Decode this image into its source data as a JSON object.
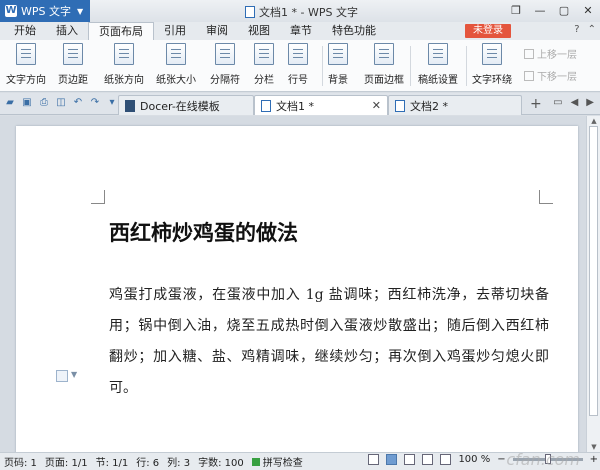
{
  "app": {
    "name": "WPS 文字",
    "window_title": "文档1 * - WPS 文字"
  },
  "menu": {
    "tabs": [
      "开始",
      "插入",
      "页面布局",
      "引用",
      "审阅",
      "视图",
      "章节",
      "特色功能"
    ],
    "active_tab": "页面布局",
    "login_label": "未登录"
  },
  "ribbon": {
    "buttons": [
      "文字方向",
      "页边距",
      "纸张方向",
      "纸张大小",
      "分隔符",
      "分栏",
      "行号",
      "背景",
      "页面边框",
      "稿纸设置",
      "文字环绕"
    ],
    "bring_forward": "上移一层",
    "send_backward": "下移一层"
  },
  "doc_tabs": [
    {
      "label": "Docer-在线模板",
      "active": false
    },
    {
      "label": "文档1 *",
      "active": true
    },
    {
      "label": "文档2 *",
      "active": false
    }
  ],
  "document": {
    "heading": "西红柿炒鸡蛋的做法",
    "lines": [
      "鸡蛋打成蛋液，在蛋液中加入 1g 盐调味；西红柿洗净，去蒂切块备",
      "用；锅中倒入油，烧至五成热时倒入蛋液炒散盛出；随后倒入西红柿",
      "翻炒；加入糖、盐、鸡精调味，继续炒匀；再次倒入鸡蛋炒匀熄火即",
      "可。"
    ]
  },
  "status": {
    "page_num": "页码: 1",
    "page": "页面: 1/1",
    "section": "节: 1/1",
    "line": "行: 6",
    "col": "列: 3",
    "chars": "字数: 100",
    "spell": "拼写检查",
    "zoom": "100 %",
    "zoom_fraction": 0.5
  },
  "watermark": "cfan.com"
}
